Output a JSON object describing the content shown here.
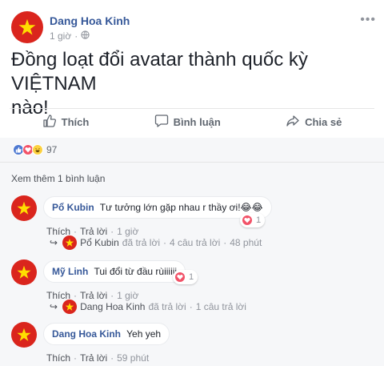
{
  "post": {
    "author": "Dang Hoa Kinh",
    "time": "1 giờ",
    "privacy_icon": "globe-icon",
    "text_line1": "Đồng loạt đổi avatar thành quốc kỳ VIỆTNAM",
    "text_line2": "nào!",
    "options_icon": "more-icon"
  },
  "actions": {
    "like": "Thích",
    "comment": "Bình luận",
    "share": "Chia sẻ"
  },
  "reactions": {
    "types": [
      "like",
      "love",
      "haha"
    ],
    "count": "97"
  },
  "comments_section": {
    "view_more": "Xem thêm 1 bình luận",
    "sep": "·",
    "comments": [
      {
        "name": "Pổ Kubin",
        "text": "Tư tưởng lớn gặp nhau r thầy ơi!😂😂",
        "reaction_count": "1",
        "like": "Thích",
        "reply": "Trả lời",
        "time": "1 giờ",
        "reply_summary": {
          "name": "Pổ Kubin",
          "action": "đã trả lời",
          "count": "4 câu trả lời",
          "time": "48 phút"
        }
      },
      {
        "name": "Mỹ Linh",
        "text": "Tui đổi từ đầu rùiiiiii",
        "reaction_count": "1",
        "like": "Thích",
        "reply": "Trả lời",
        "time": "1 giờ",
        "reply_summary": {
          "name": "Dang Hoa Kinh",
          "action": "đã trả lời",
          "count": "1 câu trả lời"
        }
      },
      {
        "name": "Dang Hoa Kinh",
        "text": "Yeh yeh",
        "like": "Thích",
        "reply": "Trả lời",
        "time": "59 phút"
      }
    ]
  },
  "colors": {
    "link": "#365899",
    "flag_red": "#da251d",
    "flag_star": "#ffde00",
    "like": "#4e79d1",
    "love": "#f25268",
    "haha": "#fcd13f"
  }
}
